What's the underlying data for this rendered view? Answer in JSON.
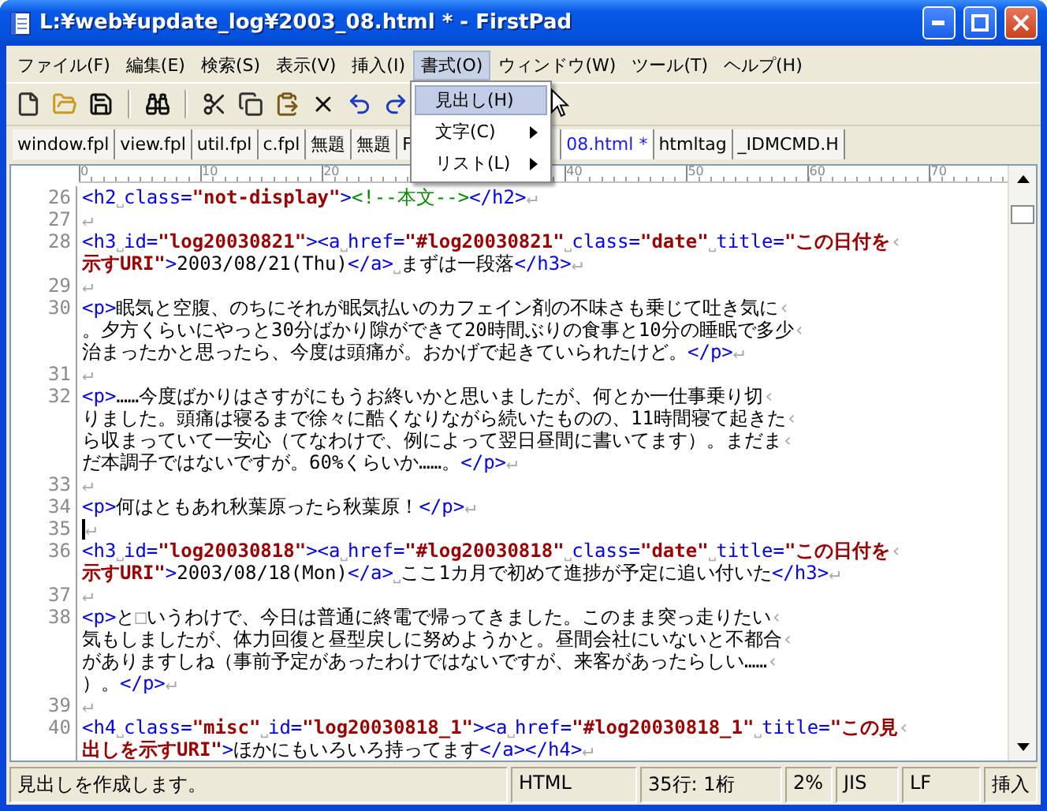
{
  "window": {
    "title": "L:¥web¥update_log¥2003_08.html * - FirstPad"
  },
  "menu": [
    {
      "label": "ファイル(F)",
      "selected": false
    },
    {
      "label": "編集(E)",
      "selected": false
    },
    {
      "label": "検索(S)",
      "selected": false
    },
    {
      "label": "表示(V)",
      "selected": false
    },
    {
      "label": "挿入(I)",
      "selected": false
    },
    {
      "label": "書式(O)",
      "selected": true,
      "items": [
        {
          "label": "見出し(H)",
          "selected": true,
          "submenu": false
        },
        {
          "label": "文字(C)",
          "selected": false,
          "submenu": true
        },
        {
          "label": "リスト(L)",
          "selected": false,
          "submenu": true
        }
      ]
    },
    {
      "label": "ウィンドウ(W)",
      "selected": false
    },
    {
      "label": "ツール(T)",
      "selected": false
    },
    {
      "label": "ヘルプ(H)",
      "selected": false
    }
  ],
  "file_tabs": [
    {
      "label": "window.fpl",
      "selected": false
    },
    {
      "label": "view.fpl",
      "selected": false
    },
    {
      "label": "util.fpl",
      "selected": false
    },
    {
      "label": "c.fpl",
      "selected": false
    },
    {
      "label": "無題",
      "selected": false
    },
    {
      "label": "無題",
      "selected": false
    },
    {
      "label": "F",
      "selected": false
    },
    {
      "label": "08.html *",
      "selected": true
    },
    {
      "label": "htmltag",
      "selected": false
    },
    {
      "label": "_IDMCMD.H",
      "selected": false
    }
  ],
  "ruler": [
    "0",
    "10",
    "20",
    "40",
    "50",
    "60",
    "70"
  ],
  "lines": [
    {
      "number": "26",
      "cursor": false,
      "rows": [
        {
          "segments": [
            {
              "kind": "tag",
              "text": "<h2"
            },
            {
              "kind": "mark",
              "text": "˽"
            },
            {
              "kind": "attr",
              "text": "class="
            },
            {
              "kind": "val",
              "text": "\"not-display\""
            },
            {
              "kind": "tag",
              "text": ">"
            },
            {
              "kind": "comment",
              "text": "<!--本文-->"
            },
            {
              "kind": "tag",
              "text": "</h2>"
            },
            {
              "kind": "mark",
              "text": "↵"
            }
          ]
        }
      ]
    },
    {
      "number": "27",
      "cursor": false,
      "rows": [
        {
          "segments": [
            {
              "kind": "mark",
              "text": "↵"
            }
          ]
        }
      ]
    },
    {
      "number": "28",
      "cursor": false,
      "rows": [
        {
          "segments": [
            {
              "kind": "tag",
              "text": "<h3"
            },
            {
              "kind": "mark",
              "text": "˽"
            },
            {
              "kind": "attr",
              "text": "id="
            },
            {
              "kind": "val",
              "text": "\"log20030821\""
            },
            {
              "kind": "tag",
              "text": "><a"
            },
            {
              "kind": "mark",
              "text": "˽"
            },
            {
              "kind": "attr",
              "text": "href="
            },
            {
              "kind": "val",
              "text": "\"#log20030821\""
            },
            {
              "kind": "mark",
              "text": "˽"
            },
            {
              "kind": "attr",
              "text": "class="
            },
            {
              "kind": "val",
              "text": "\"date\""
            },
            {
              "kind": "mark",
              "text": "˽"
            },
            {
              "kind": "attr",
              "text": "title="
            },
            {
              "kind": "val",
              "text": "\"この日付を"
            },
            {
              "kind": "mark",
              "text": "‹"
            }
          ]
        },
        {
          "segments": [
            {
              "kind": "val",
              "text": "示すURI\""
            },
            {
              "kind": "tag",
              "text": ">"
            },
            {
              "kind": "text",
              "text": "2003/08/21(Thu)"
            },
            {
              "kind": "tag",
              "text": "</a>"
            },
            {
              "kind": "mark",
              "text": "˽"
            },
            {
              "kind": "text",
              "text": "まずは一段落"
            },
            {
              "kind": "tag",
              "text": "</h3>"
            },
            {
              "kind": "mark",
              "text": "↵"
            }
          ]
        }
      ]
    },
    {
      "number": "29",
      "cursor": false,
      "rows": [
        {
          "segments": [
            {
              "kind": "mark",
              "text": "↵"
            }
          ]
        }
      ]
    },
    {
      "number": "30",
      "cursor": false,
      "rows": [
        {
          "segments": [
            {
              "kind": "tag",
              "text": "<p>"
            },
            {
              "kind": "text",
              "text": "眠気と空腹、のちにそれが眠気払いのカフェイン剤の不味さも乗じて吐き気に"
            },
            {
              "kind": "mark",
              "text": "‹"
            }
          ]
        },
        {
          "segments": [
            {
              "kind": "text",
              "text": "。夕方くらいにやっと30分ばかり隙ができて20時間ぶりの食事と10分の睡眠で多少"
            },
            {
              "kind": "mark",
              "text": "‹"
            }
          ]
        },
        {
          "segments": [
            {
              "kind": "text",
              "text": "治まったかと思ったら、今度は頭痛が。おかげで起きていられたけど。"
            },
            {
              "kind": "tag",
              "text": "</p>"
            },
            {
              "kind": "mark",
              "text": "↵"
            }
          ]
        }
      ]
    },
    {
      "number": "31",
      "cursor": false,
      "rows": [
        {
          "segments": [
            {
              "kind": "mark",
              "text": "↵"
            }
          ]
        }
      ]
    },
    {
      "number": "32",
      "cursor": false,
      "rows": [
        {
          "segments": [
            {
              "kind": "tag",
              "text": "<p>"
            },
            {
              "kind": "text",
              "text": "……今度ばかりはさすがにもうお終いかと思いましたが、何とか一仕事乗り切"
            },
            {
              "kind": "mark",
              "text": "‹"
            }
          ]
        },
        {
          "segments": [
            {
              "kind": "text",
              "text": "りました。頭痛は寝るまで徐々に酷くなりながら続いたものの、11時間寝て起きた"
            },
            {
              "kind": "mark",
              "text": "‹"
            }
          ]
        },
        {
          "segments": [
            {
              "kind": "text",
              "text": "ら収まっていて一安心（てなわけで、例によって翌日昼間に書いてます）。まだま"
            },
            {
              "kind": "mark",
              "text": "‹"
            }
          ]
        },
        {
          "segments": [
            {
              "kind": "text",
              "text": "だ本調子ではないですが。60%くらいか……。"
            },
            {
              "kind": "tag",
              "text": "</p>"
            },
            {
              "kind": "mark",
              "text": "↵"
            }
          ]
        }
      ]
    },
    {
      "number": "33",
      "cursor": false,
      "rows": [
        {
          "segments": [
            {
              "kind": "mark",
              "text": "↵"
            }
          ]
        }
      ]
    },
    {
      "number": "34",
      "cursor": false,
      "rows": [
        {
          "segments": [
            {
              "kind": "tag",
              "text": "<p>"
            },
            {
              "kind": "text",
              "text": "何はともあれ秋葉原ったら秋葉原！"
            },
            {
              "kind": "tag",
              "text": "</p>"
            },
            {
              "kind": "mark",
              "text": "↵"
            }
          ]
        }
      ]
    },
    {
      "number": "35",
      "cursor": true,
      "rows": [
        {
          "segments": [
            {
              "kind": "mark",
              "text": "↵"
            }
          ]
        }
      ]
    },
    {
      "number": "36",
      "cursor": false,
      "rows": [
        {
          "segments": [
            {
              "kind": "tag",
              "text": "<h3"
            },
            {
              "kind": "mark",
              "text": "˽"
            },
            {
              "kind": "attr",
              "text": "id="
            },
            {
              "kind": "val",
              "text": "\"log20030818\""
            },
            {
              "kind": "tag",
              "text": "><a"
            },
            {
              "kind": "mark",
              "text": "˽"
            },
            {
              "kind": "attr",
              "text": "href="
            },
            {
              "kind": "val",
              "text": "\"#log20030818\""
            },
            {
              "kind": "mark",
              "text": "˽"
            },
            {
              "kind": "attr",
              "text": "class="
            },
            {
              "kind": "val",
              "text": "\"date\""
            },
            {
              "kind": "mark",
              "text": "˽"
            },
            {
              "kind": "attr",
              "text": "title="
            },
            {
              "kind": "val",
              "text": "\"この日付を"
            },
            {
              "kind": "mark",
              "text": "‹"
            }
          ]
        },
        {
          "segments": [
            {
              "kind": "val",
              "text": "示すURI\""
            },
            {
              "kind": "tag",
              "text": ">"
            },
            {
              "kind": "text",
              "text": "2003/08/18(Mon)"
            },
            {
              "kind": "tag",
              "text": "</a>"
            },
            {
              "kind": "mark",
              "text": "˽"
            },
            {
              "kind": "text",
              "text": "ここ1カ月で初めて進捗が予定に追い付いた"
            },
            {
              "kind": "tag",
              "text": "</h3>"
            },
            {
              "kind": "mark",
              "text": "↵"
            }
          ]
        }
      ]
    },
    {
      "number": "37",
      "cursor": false,
      "rows": [
        {
          "segments": [
            {
              "kind": "mark",
              "text": "↵"
            }
          ]
        }
      ]
    },
    {
      "number": "38",
      "cursor": false,
      "rows": [
        {
          "segments": [
            {
              "kind": "tag",
              "text": "<p>"
            },
            {
              "kind": "text",
              "text": "と"
            },
            {
              "kind": "mark",
              "text": "□"
            },
            {
              "kind": "text",
              "text": "いうわけで、今日は普通に終電で帰ってきました。このまま突っ走りたい"
            },
            {
              "kind": "mark",
              "text": "‹"
            }
          ]
        },
        {
          "segments": [
            {
              "kind": "text",
              "text": "気もしましたが、体力回復と昼型戻しに努めようかと。昼間会社にいないと不都合"
            },
            {
              "kind": "mark",
              "text": "‹"
            }
          ]
        },
        {
          "segments": [
            {
              "kind": "text",
              "text": "がありますしね（事前予定があったわけではないですが、来客があったらしい……"
            },
            {
              "kind": "mark",
              "text": "‹"
            }
          ]
        },
        {
          "segments": [
            {
              "kind": "text",
              "text": "）。"
            },
            {
              "kind": "tag",
              "text": "</p>"
            },
            {
              "kind": "mark",
              "text": "↵"
            }
          ]
        }
      ]
    },
    {
      "number": "39",
      "cursor": false,
      "rows": [
        {
          "segments": [
            {
              "kind": "mark",
              "text": "↵"
            }
          ]
        }
      ]
    },
    {
      "number": "40",
      "cursor": false,
      "rows": [
        {
          "segments": [
            {
              "kind": "tag",
              "text": "<h4"
            },
            {
              "kind": "mark",
              "text": "˽"
            },
            {
              "kind": "attr",
              "text": "class="
            },
            {
              "kind": "val",
              "text": "\"misc\""
            },
            {
              "kind": "mark",
              "text": "˽"
            },
            {
              "kind": "attr",
              "text": "id="
            },
            {
              "kind": "val",
              "text": "\"log20030818_1\""
            },
            {
              "kind": "tag",
              "text": "><a"
            },
            {
              "kind": "mark",
              "text": "˽"
            },
            {
              "kind": "attr",
              "text": "href="
            },
            {
              "kind": "val",
              "text": "\"#log20030818_1\""
            },
            {
              "kind": "mark",
              "text": "˽"
            },
            {
              "kind": "attr",
              "text": "title="
            },
            {
              "kind": "val",
              "text": "\"この見"
            },
            {
              "kind": "mark",
              "text": "‹"
            }
          ]
        },
        {
          "segments": [
            {
              "kind": "val",
              "text": "出しを示すURI\""
            },
            {
              "kind": "tag",
              "text": ">"
            },
            {
              "kind": "text",
              "text": "ほかにもいろいろ持ってます"
            },
            {
              "kind": "tag",
              "text": "</a></h4>"
            },
            {
              "kind": "mark",
              "text": "↵"
            }
          ]
        }
      ]
    }
  ],
  "status_bar": [
    "見出しを作成します。",
    "HTML",
    "35行: 1桁",
    "2%",
    "JIS",
    "LF",
    "挿入"
  ]
}
